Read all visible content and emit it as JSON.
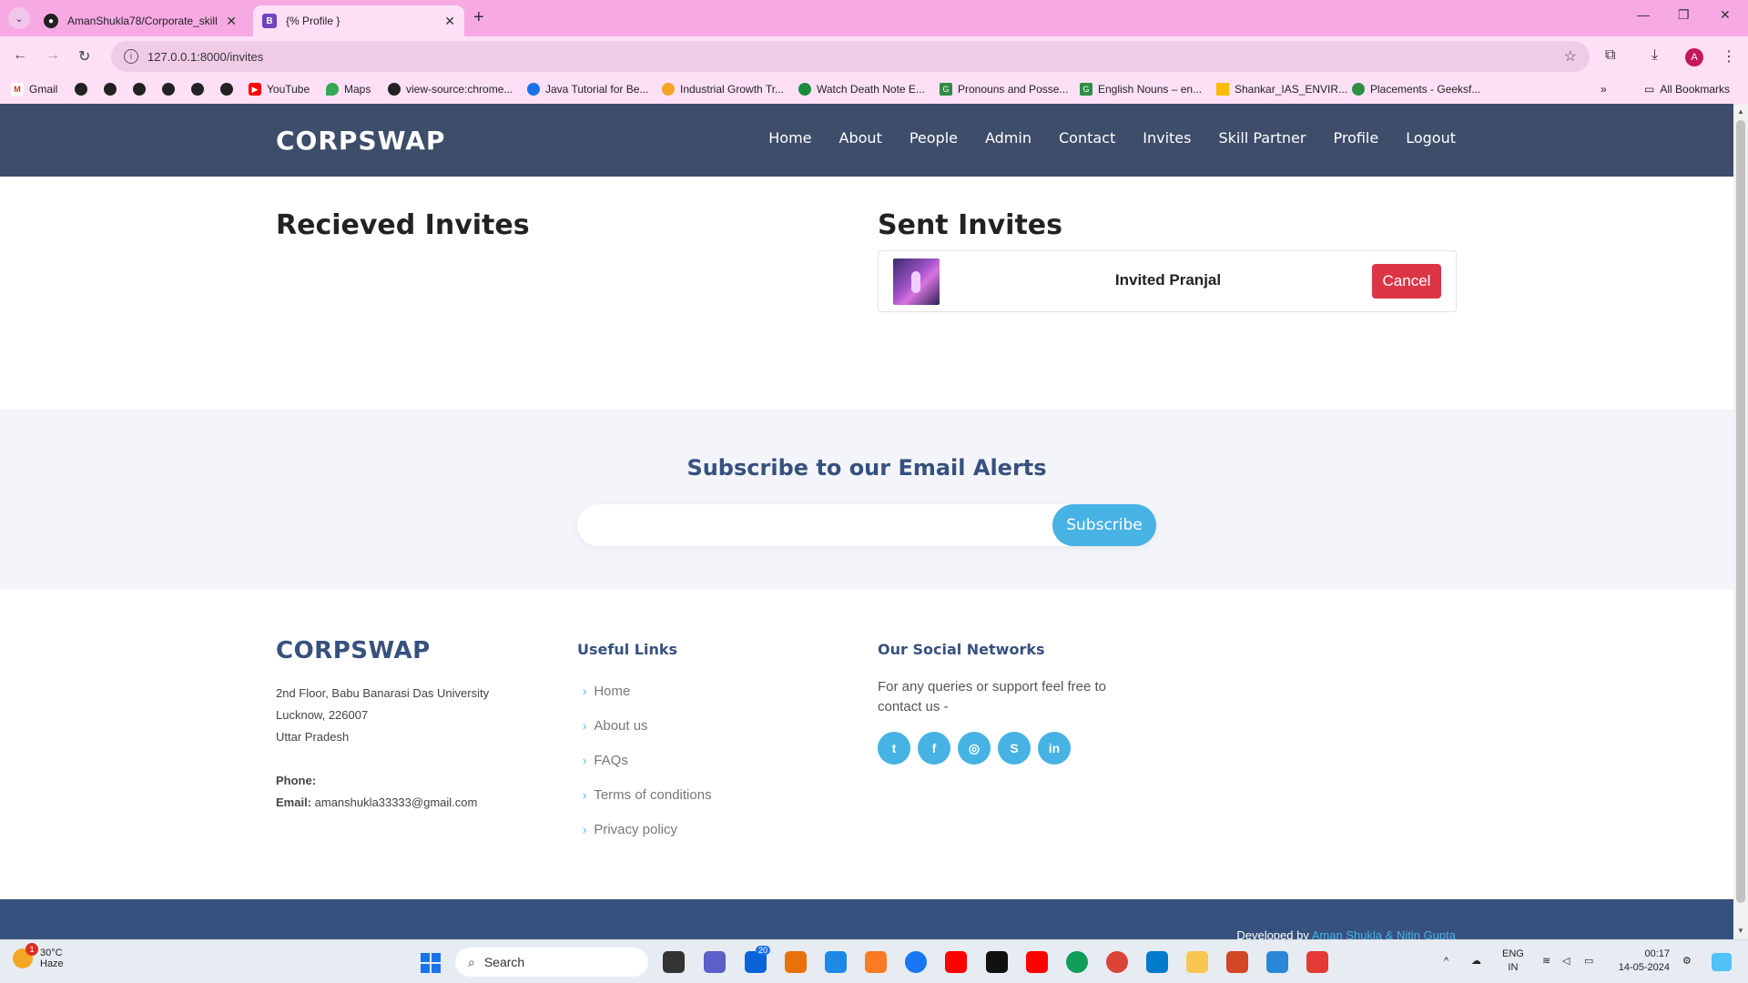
{
  "browser": {
    "tabs": [
      {
        "title": "AmanShukla78/Corporate_skill"
      },
      {
        "title": "{% Profile }"
      }
    ],
    "url": "127.0.0.1:8000/invites",
    "profile_initial": "A",
    "bookmarks": [
      {
        "label": "Gmail",
        "icon": "gmail-icon"
      },
      {
        "label": "",
        "icon": "globe-icon"
      },
      {
        "label": "",
        "icon": "globe-icon"
      },
      {
        "label": "",
        "icon": "globe-icon"
      },
      {
        "label": "",
        "icon": "globe-icon"
      },
      {
        "label": "",
        "icon": "globe-icon"
      },
      {
        "label": "",
        "icon": "globe-icon"
      },
      {
        "label": "YouTube",
        "icon": "youtube-icon"
      },
      {
        "label": "Maps",
        "icon": "maps-icon"
      },
      {
        "label": "view-source:chrome...",
        "icon": "globe-icon"
      },
      {
        "label": "Java Tutorial for Be...",
        "icon": "java-icon"
      },
      {
        "label": "Industrial Growth Tr...",
        "icon": "bulb-icon"
      },
      {
        "label": "Watch Death Note E...",
        "icon": "tv-icon"
      },
      {
        "label": "Pronouns and Posse...",
        "icon": "grammar-icon"
      },
      {
        "label": "English Nouns – en...",
        "icon": "grammar-icon"
      },
      {
        "label": "Shankar_IAS_ENVIR...",
        "icon": "drive-icon"
      },
      {
        "label": "Placements - Geeksf...",
        "icon": "gfg-icon"
      }
    ],
    "all_bookmarks": "All Bookmarks"
  },
  "site": {
    "brand": "CORPSWAP",
    "nav": [
      "Home",
      "About",
      "People",
      "Admin",
      "Contact",
      "Invites",
      "Skill Partner",
      "Profile",
      "Logout"
    ]
  },
  "invites": {
    "received_title": "Recieved Invites",
    "sent_title": "Sent Invites",
    "sent": [
      {
        "text": "Invited Pranjal",
        "action": "Cancel"
      }
    ]
  },
  "subscribe": {
    "title": "Subscribe to our Email Alerts",
    "input_value": "",
    "button": "Subscribe"
  },
  "footer": {
    "brand": "CORPSWAP",
    "address": [
      "2nd Floor, Babu Banarasi Das University",
      "Lucknow, 226007",
      "Uttar Pradesh"
    ],
    "phone_label": "Phone:",
    "phone_value": "",
    "email_label": "Email:",
    "email_value": "amanshukla33333@gmail.com",
    "links_title": "Useful Links",
    "links": [
      "Home",
      "About us",
      "FAQs",
      "Terms of conditions",
      "Privacy policy"
    ],
    "social_title": "Our Social Networks",
    "social_text": "For any queries or support feel free to contact us -",
    "socials": [
      "twitter-icon",
      "facebook-icon",
      "instagram-icon",
      "skype-icon",
      "linkedin-icon"
    ],
    "credit_prefix": "Developed by",
    "credit_names": "Aman Shukla & Nitin Gupta"
  },
  "taskbar": {
    "temperature": "30°C",
    "weather": "Haze",
    "weather_badge": "1",
    "search_placeholder": "Search",
    "mail_badge": "20",
    "language": "ENG",
    "region": "IN",
    "time": "00:17",
    "date": "14-05-2024"
  },
  "colors": {
    "header_bg": "#3d4d6a",
    "accent": "#47b2e4",
    "brand_dark": "#37517e",
    "danger": "#dc3545",
    "tabbar": "#f7a9e4"
  }
}
